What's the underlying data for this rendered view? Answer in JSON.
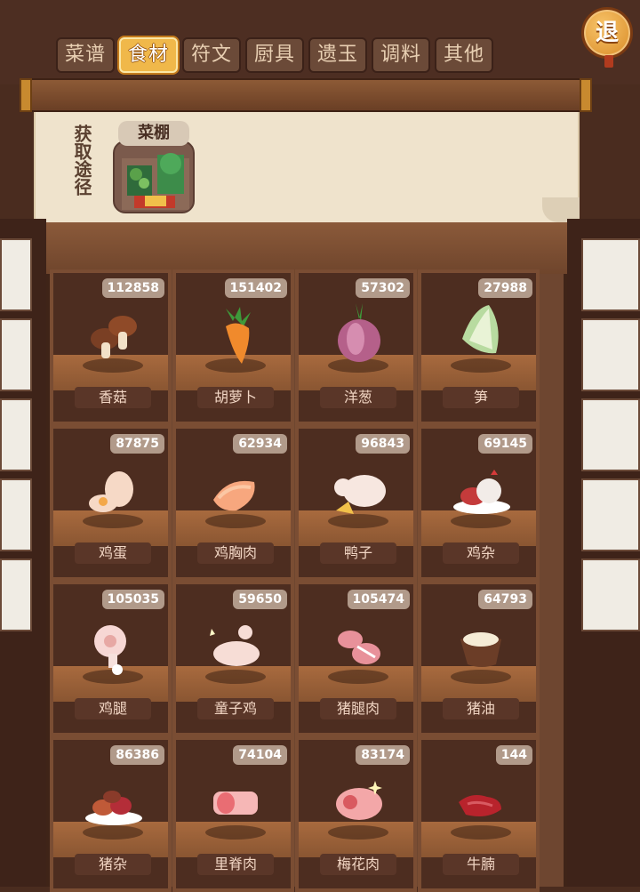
{
  "tabs": [
    {
      "label": "菜谱",
      "active": false
    },
    {
      "label": "食材",
      "active": true
    },
    {
      "label": "符文",
      "active": false
    },
    {
      "label": "厨具",
      "active": false
    },
    {
      "label": "遗玉",
      "active": false
    },
    {
      "label": "调料",
      "active": false
    },
    {
      "label": "其他",
      "active": false
    }
  ],
  "exit": {
    "label": "退"
  },
  "source": {
    "label": "获取途径",
    "place": "菜棚",
    "place_img_tag": "菜棚"
  },
  "ingredients": [
    {
      "name": "香菇",
      "count": "112858",
      "icon": "mushroom-icon"
    },
    {
      "name": "胡萝卜",
      "count": "151402",
      "icon": "carrot-icon"
    },
    {
      "name": "洋葱",
      "count": "57302",
      "icon": "onion-icon"
    },
    {
      "name": "笋",
      "count": "27988",
      "icon": "bamboo-shoot-icon"
    },
    {
      "name": "鸡蛋",
      "count": "87875",
      "icon": "egg-icon"
    },
    {
      "name": "鸡胸肉",
      "count": "62934",
      "icon": "chicken-breast-icon"
    },
    {
      "name": "鸭子",
      "count": "96843",
      "icon": "duck-icon"
    },
    {
      "name": "鸡杂",
      "count": "69145",
      "icon": "chicken-giblets-icon"
    },
    {
      "name": "鸡腿",
      "count": "105035",
      "icon": "chicken-leg-icon"
    },
    {
      "name": "童子鸡",
      "count": "59650",
      "icon": "young-chicken-icon"
    },
    {
      "name": "猪腿肉",
      "count": "105474",
      "icon": "pork-leg-icon"
    },
    {
      "name": "猪油",
      "count": "64793",
      "icon": "lard-icon"
    },
    {
      "name": "猪杂",
      "count": "86386",
      "icon": "pork-offal-icon"
    },
    {
      "name": "里脊肉",
      "count": "74104",
      "icon": "tenderloin-icon"
    },
    {
      "name": "梅花肉",
      "count": "83174",
      "icon": "pork-shoulder-icon"
    },
    {
      "name": "牛腩",
      "count": "144",
      "icon": "beef-brisket-icon"
    }
  ],
  "colors": {
    "accent": "#f0b84a",
    "shelf": "#7a4d33",
    "panel": "#efe3cc"
  }
}
